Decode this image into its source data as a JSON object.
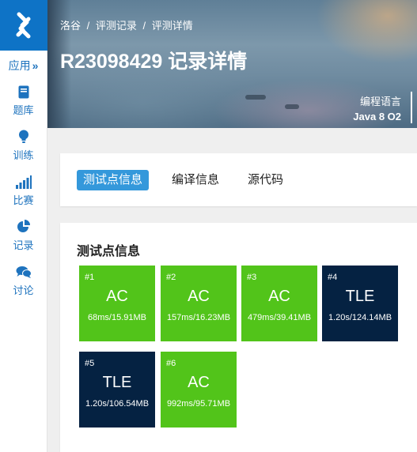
{
  "sidebar": {
    "app_label": "应用",
    "app_arrows": "»",
    "items": [
      {
        "label": "题库",
        "icon": "book-icon"
      },
      {
        "label": "训练",
        "icon": "lightbulb-icon"
      },
      {
        "label": "比赛",
        "icon": "signal-bars-icon"
      },
      {
        "label": "记录",
        "icon": "pie-chart-icon"
      },
      {
        "label": "讨论",
        "icon": "chat-bubbles-icon"
      }
    ],
    "accent": "#1e73be"
  },
  "header": {
    "breadcrumb": [
      "洛谷",
      "/",
      "评测记录",
      "/",
      "评测详情"
    ],
    "title": "R23098429 记录详情",
    "lang_label": "编程语言",
    "lang_value": "Java 8 O2"
  },
  "tabs": [
    {
      "label": "测试点信息",
      "active": true
    },
    {
      "label": "编译信息",
      "active": false
    },
    {
      "label": "源代码",
      "active": false
    }
  ],
  "tests": {
    "title": "测试点信息",
    "cases": [
      {
        "num": "#1",
        "status": "AC",
        "result": "68ms/15.91MB"
      },
      {
        "num": "#2",
        "status": "AC",
        "result": "157ms/16.23MB"
      },
      {
        "num": "#3",
        "status": "AC",
        "result": "479ms/39.41MB"
      },
      {
        "num": "#4",
        "status": "TLE",
        "result": "1.20s/124.14MB"
      },
      {
        "num": "#5",
        "status": "TLE",
        "result": "1.20s/106.54MB"
      },
      {
        "num": "#6",
        "status": "AC",
        "result": "992ms/95.71MB"
      }
    ]
  },
  "colors": {
    "ac": "#52c41a",
    "tle": "#052242",
    "tab_active": "#3498db",
    "logo_bg": "#0e73c6"
  }
}
